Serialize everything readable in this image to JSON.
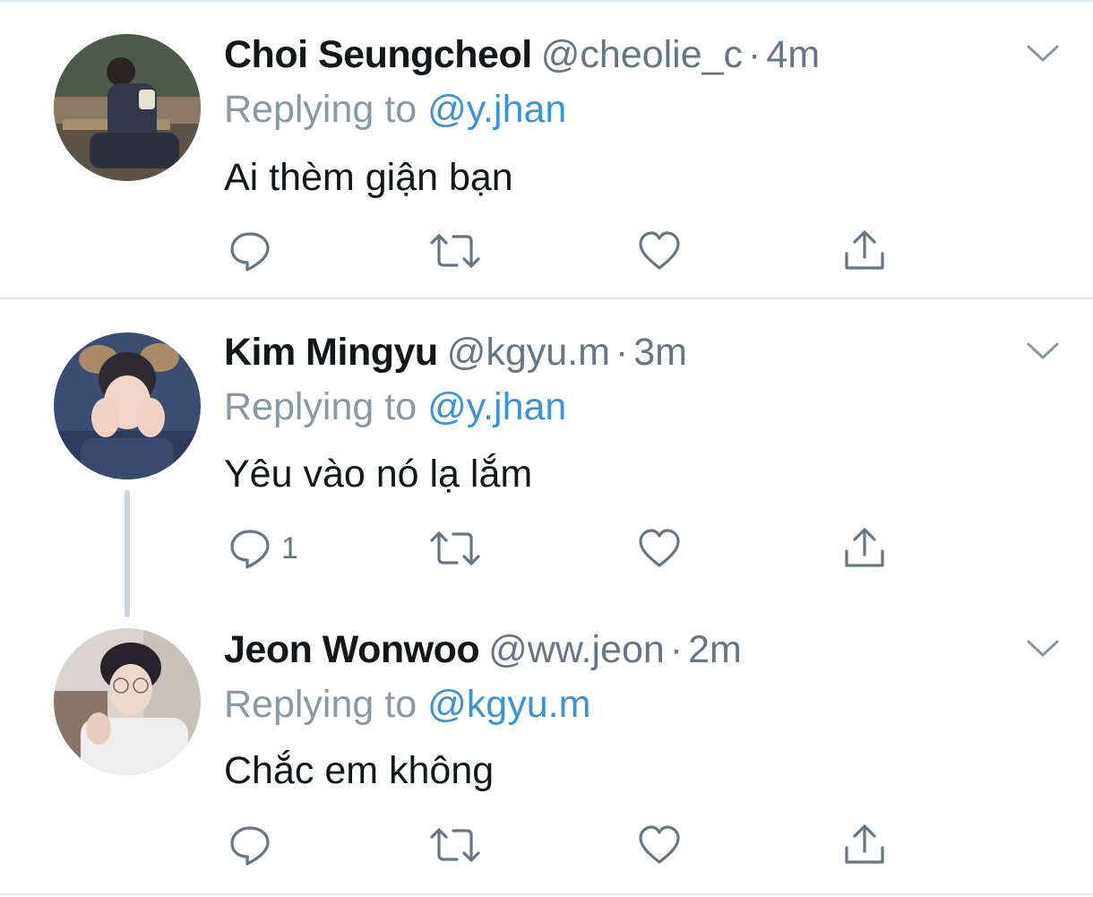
{
  "colors": {
    "name": "#14171a",
    "secondary": "#657786",
    "reply_label": "#8899a6",
    "mention": "#3b94d9",
    "divider": "#e1e8ed",
    "thread_line": "#ccd6dd"
  },
  "tweets": [
    {
      "display_name": "Choi Seungcheol",
      "handle": "@cheolie_c",
      "separator": "·",
      "time": "4m",
      "replying_label": "Replying to",
      "replying_to": "@y.jhan",
      "text": "Ai thèm giận bạn",
      "reply_count": "",
      "icons": [
        "reply-icon",
        "retweet-icon",
        "like-icon",
        "share-icon",
        "chevron-down-icon"
      ]
    },
    {
      "display_name": "Kim Mingyu",
      "handle": "@kgyu.m",
      "separator": "·",
      "time": "3m",
      "replying_label": "Replying to",
      "replying_to": "@y.jhan",
      "text": "Yêu vào nó lạ lắm",
      "reply_count": "1",
      "icons": [
        "reply-icon",
        "retweet-icon",
        "like-icon",
        "share-icon",
        "chevron-down-icon"
      ]
    },
    {
      "display_name": "Jeon Wonwoo",
      "handle": "@ww.jeon",
      "separator": "·",
      "time": "2m",
      "replying_label": "Replying to",
      "replying_to": "@kgyu.m",
      "text": "Chắc em không",
      "reply_count": "",
      "icons": [
        "reply-icon",
        "retweet-icon",
        "like-icon",
        "share-icon",
        "chevron-down-icon"
      ]
    }
  ]
}
